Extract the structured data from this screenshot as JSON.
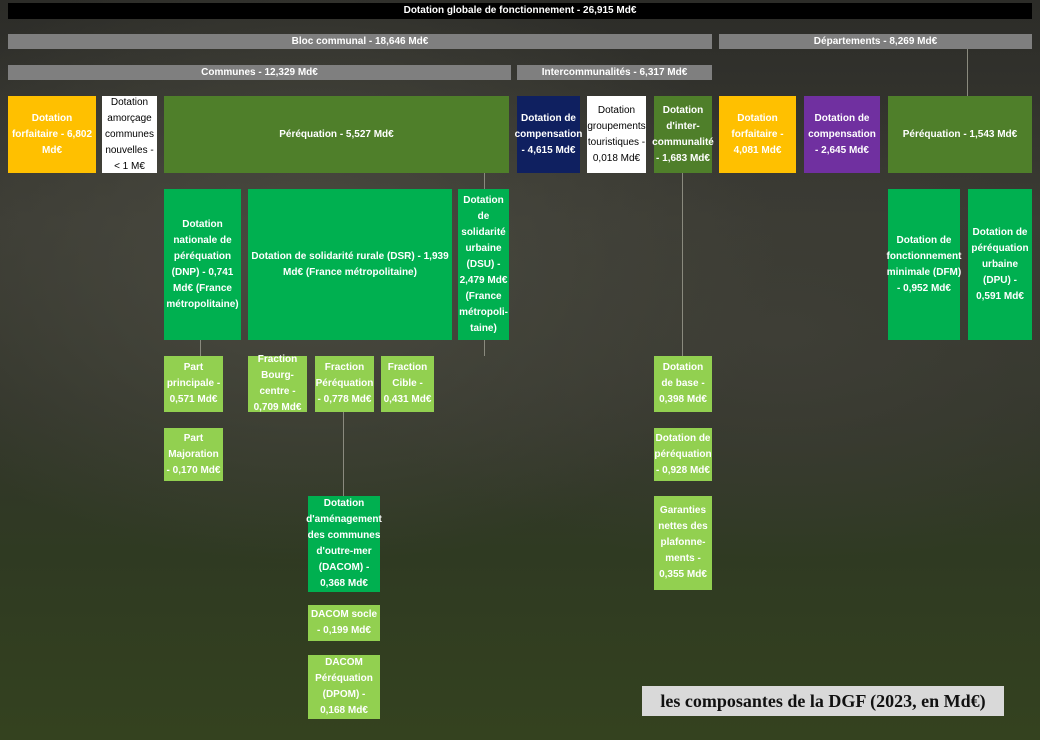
{
  "top": {
    "label": "Dotation globale de fonctionnement - 26,915 Md€"
  },
  "bloc_communal": {
    "label": "Bloc communal - 18,646 Md€"
  },
  "departements": {
    "label": "Départements - 8,269 Md€"
  },
  "communes": {
    "label": "Communes - 12,329 Md€"
  },
  "intercommunalites": {
    "label": "Intercommunalités - 6,317 Md€"
  },
  "boxes": {
    "dotation_forfaitaire_communes": "Dotation forfaitaire - 6,802 Md€",
    "dotation_amorcage": "Dotation amorçage communes nouvelles - < 1 M€",
    "perequation_communes": "Péréquation - 5,527 Md€",
    "dotation_compensation_interco": "Dotation de compensation - 4,615 Md€",
    "dotation_groupements": "Dotation groupements touristiques - 0,018 Md€",
    "dotation_intercommunalite": "Dotation d'inter-communalité - 1,683 Md€",
    "dotation_forfaitaire_dep": "Dotation forfaitaire - 4,081 Md€",
    "dotation_compensation_dep": "Dotation de compensation - 2,645 Md€",
    "perequation_dep": "Péréquation - 1,543 Md€",
    "dnp": "Dotation nationale de péréquation (DNP) - 0,741 Md€ (France métropolitaine)",
    "dsr": "Dotation de solidarité rurale (DSR) - 1,939 Md€ (France métropolitaine)",
    "dsu": "Dotation de solidarité urbaine (DSU) - 2,479 Md€ (France métropoli-taine)",
    "dfm": "Dotation de fonctionnement minimale (DFM) - 0,952 Md€",
    "dpu": "Dotation de péréquation urbaine (DPU) - 0,591 Md€",
    "part_principale": "Part principale - 0,571 Md€",
    "part_majoration": "Part Majoration - 0,170 Md€",
    "fraction_bourg": "Fraction Bourg-centre - 0,709 Md€",
    "fraction_perequation": "Fraction Péréquation - 0,778 Md€",
    "fraction_cible": "Fraction Cible - 0,431 Md€",
    "dotation_base": "Dotation de base - 0,398 Md€",
    "dotation_perequation": "Dotation de péréquation - 0,928 Md€",
    "garanties": "Garanties nettes des plafonne-ments - 0,355 Md€",
    "dacom": "Dotation d'aménagement des communes d'outre-mer (DACOM) - 0,368 Md€",
    "dacom_socle": "DACOM socle - 0,199 Md€",
    "dacom_dpom": "DACOM Péréquation (DPOM) - 0,168 Md€"
  },
  "caption": "les composantes de la DGF (2023, en Md€)",
  "colors": {
    "yellow": "#ffc000",
    "dark_green": "#4f7f2a",
    "green": "#00b050",
    "light_green": "#92d050",
    "navy": "#0f2060",
    "purple": "#7030a0",
    "bar_grey": "#7f7f7f"
  }
}
